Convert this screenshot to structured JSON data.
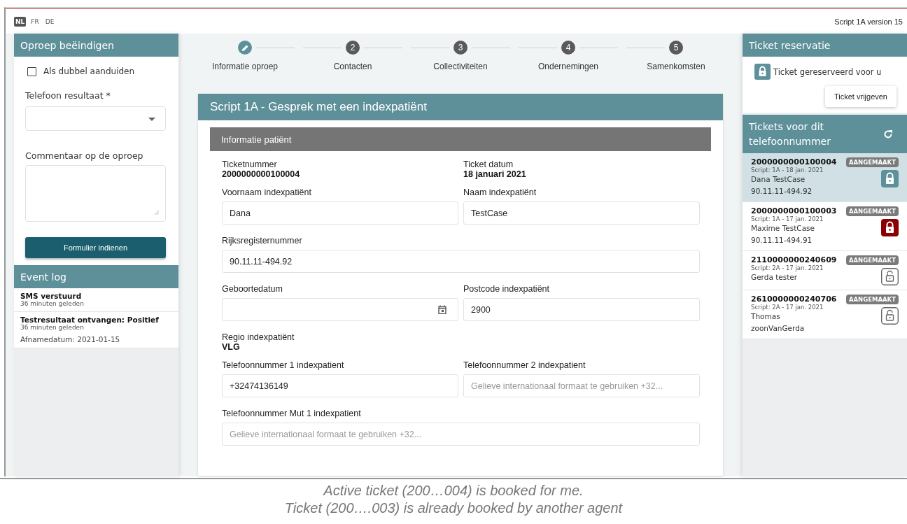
{
  "languages": [
    {
      "label": "NL",
      "selected": true
    },
    {
      "label": "FR",
      "selected": false
    },
    {
      "label": "DE",
      "selected": false
    }
  ],
  "version": "Script 1A version 15",
  "end_call": {
    "title": "Oproep beëindigen",
    "duplicate": {
      "label": "Als dubbel aanduiden",
      "checked": false
    },
    "result_label": "Telefoon resultaat *",
    "comment_label": "Commentaar op de oproep",
    "submit": "Formulier indienen"
  },
  "event_log": {
    "title": "Event log",
    "events": [
      {
        "title": "SMS verstuurd",
        "time": "36 minuten geleden"
      },
      {
        "title": "Testresultaat ontvangen: Positief",
        "time": "36 minuten geleden",
        "detail": "Afnamedatum: 2021-01-15"
      }
    ]
  },
  "steps": [
    {
      "kind": "edit",
      "label": "Informatie oproep",
      "selected": true
    },
    {
      "kind": "number",
      "number": "2",
      "label": "Contacten",
      "selected": false
    },
    {
      "kind": "number",
      "number": "3",
      "label": "Collectiviteiten",
      "selected": false
    },
    {
      "kind": "number",
      "number": "4",
      "label": "Ondernemingen",
      "selected": false
    },
    {
      "kind": "number",
      "number": "5",
      "label": "Samenkomsten",
      "selected": false
    }
  ],
  "form": {
    "title": "Script 1A - Gesprek met een indexpatiënt",
    "section": "Informatie patiënt",
    "rows": [
      [
        {
          "kind": "static",
          "label": "Ticketnummer",
          "value": "2000000000100004"
        },
        {
          "kind": "static",
          "label": "Ticket datum",
          "value": "18 januari 2021"
        }
      ],
      [
        {
          "kind": "input",
          "label": "Voornaam indexpatiënt",
          "value": "Dana"
        },
        {
          "kind": "input",
          "label": "Naam indexpatiënt",
          "value": "TestCase"
        }
      ],
      [
        {
          "kind": "input",
          "label": "Rijksregisternummer",
          "value": "90.11.11-494.92"
        }
      ],
      [
        {
          "kind": "date",
          "label": "Geboortedatum"
        },
        {
          "kind": "input",
          "label": "Postcode indexpatiënt",
          "value": "2900"
        }
      ],
      [
        {
          "kind": "static",
          "label": "Regio indexpatiënt",
          "value": "VLG"
        }
      ],
      [
        {
          "kind": "input",
          "label": "Telefoonnummer 1 indexpatient",
          "value": "+32474136149"
        },
        {
          "kind": "input",
          "label": "Telefoonnummer 2 indexpatient",
          "placeholder": "Gelieve internationaal formaat te gebruiken +32..."
        }
      ],
      [
        {
          "kind": "input",
          "label": "Telefoonnummer Mut 1 indexpatient",
          "placeholder": "Gelieve internationaal formaat te gebruiken +32..."
        }
      ]
    ]
  },
  "reservation": {
    "title": "Ticket reservatie",
    "status": "Ticket gereserveerd voor u",
    "release": "Ticket vrijgeven"
  },
  "tickets": {
    "title": "Tickets voor dit telefoonnummer",
    "items": [
      {
        "number": "2000000000100004",
        "meta": "Script: 1A - 18 jan. 2021",
        "name": "Dana TestCase",
        "id": "90.11.11-494.92",
        "status": "AANGEMAAKT",
        "kind": "mine",
        "selected": true
      },
      {
        "number": "2000000000100003",
        "meta": "Script: 1A - 17 jan. 2021",
        "name": "Maxime TestCase",
        "id": "90.11.11-494.91",
        "status": "AANGEMAAKT",
        "kind": "other",
        "selected": false
      },
      {
        "number": "2110000000240609",
        "meta": "Script: 2A - 17 jan. 2021",
        "name": "Gerda tester",
        "status": "AANGEMAAKT",
        "kind": "free",
        "selected": false
      },
      {
        "number": "2610000000240706",
        "meta": "Script: 2A - 17 jan. 2021",
        "name": "Thomas zoonVanGerda",
        "status": "AANGEMAAKT",
        "kind": "free",
        "selected": false
      }
    ]
  },
  "caption": [
    "Active ticket (200…004) is booked for me.",
    "Ticket (200….003) is already booked by another agent"
  ]
}
